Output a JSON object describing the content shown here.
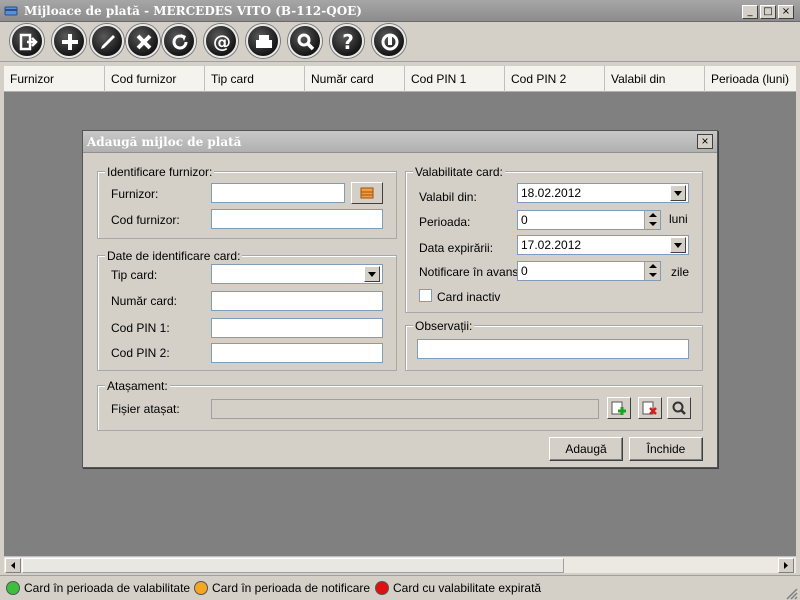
{
  "window": {
    "title": "Mijloace de plată - MERCEDES VITO (B-112-QOE)",
    "minimize": "_",
    "maximize": "□",
    "close": "×"
  },
  "toolbar": {
    "buttons": [
      "exit-icon",
      "add-icon",
      "edit-icon",
      "delete-icon",
      "refresh-icon",
      "email-icon",
      "print-icon",
      "search-icon",
      "help-icon",
      "power-icon"
    ]
  },
  "grid": {
    "columns": [
      "Furnizor",
      "Cod furnizor",
      "Tip card",
      "Număr card",
      "Cod PIN 1",
      "Cod PIN 2",
      "Valabil din",
      "Perioada (luni)"
    ]
  },
  "status": {
    "items": [
      {
        "color": "#3cc03c",
        "label": "Card în perioada de valabilitate"
      },
      {
        "color": "#f5a623",
        "label": "Card în perioada de notificare"
      },
      {
        "color": "#e01010",
        "label": "Card cu valabilitate expirată"
      }
    ]
  },
  "dialog": {
    "title": "Adaugă mijloc de plată",
    "close": "×",
    "supplier_group": {
      "label": "Identificare furnizor:",
      "supplier_label": "Furnizor:",
      "supplier_value": "",
      "code_label": "Cod furnizor:",
      "code_value": ""
    },
    "card_group": {
      "label": "Date de identificare card:",
      "type_label": "Tip card:",
      "type_value": "",
      "number_label": "Număr card:",
      "number_value": "",
      "pin1_label": "Cod PIN 1:",
      "pin1_value": "",
      "pin2_label": "Cod PIN 2:",
      "pin2_value": ""
    },
    "validity_group": {
      "label": "Valabilitate card:",
      "from_label": "Valabil din:",
      "from_value": "18.02.2012",
      "period_label": "Perioada:",
      "period_value": "0",
      "period_unit": "luni",
      "expiry_label": "Data expirării:",
      "expiry_value": "17.02.2012",
      "notify_label": "Notificare în avans:",
      "notify_value": "0",
      "notify_unit": "zile",
      "inactive_label": "Card inactiv"
    },
    "notes_group": {
      "label": "Observații:",
      "value": ""
    },
    "attachment_group": {
      "label": "Atașament:",
      "file_label": "Fișier atașat:",
      "file_value": ""
    },
    "add_button": "Adaugă",
    "close_button": "Închide"
  }
}
